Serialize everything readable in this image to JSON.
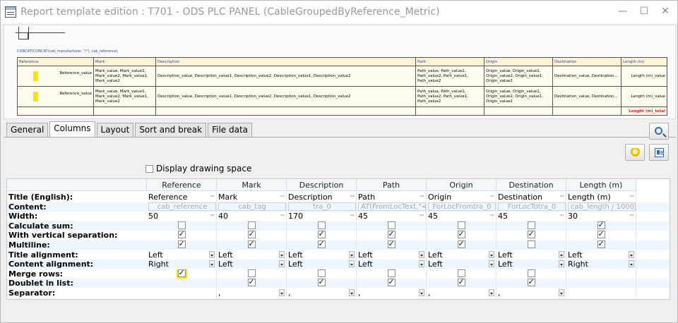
{
  "window": {
    "title": "Report template edition : T701 - ODS PLC PANEL (CableGroupedByReference_Metric)",
    "buttons": {
      "minimize": "—",
      "maximize": "☐",
      "close": "✕"
    }
  },
  "preview": {
    "formula": "CONCAT(CONCAT(cab_manufacturer, \"/\"), cab_reference)",
    "headers": [
      "Reference",
      "Mark",
      "Description",
      "Path",
      "Origin",
      "Destination",
      "Length (m)"
    ],
    "rows": [
      {
        "reference": "Reference_value",
        "mark": "Mark_value, Mark_value1, Mark_value2, Mark_value1, Mark_value2",
        "description": "Description_value, Description_value1, Description_value2, Description_value1, Description_value2",
        "path": "Path_value, Path_value1, Path_value2, Path_value1, Path_value2",
        "origin": "Origin_value, Origin_value1, Origin_value2, Origin_value1, Origin_value2",
        "destination": "Destination_value, Destination...",
        "length": "Length (m)_value"
      },
      {
        "reference": "Reference_value",
        "mark": "Mark_value, Mark_value1, Mark_value2, Mark_value1, Mark_value2",
        "description": "Description_value, Description_value1, Description_value2, Description_value1, Description_value2",
        "path": "Path_value, Path_value1, Path_value2, Path_value1, Path_value2",
        "origin": "Origin_value, Origin_value1, Origin_value2, Origin_value1, Origin_value2",
        "destination": "Destination_value, Destination...",
        "length": "Length (m)_value"
      }
    ],
    "total": "Length (m)_total"
  },
  "tabs": [
    "General",
    "Columns",
    "Layout",
    "Sort and break",
    "File data"
  ],
  "active_tab": "Columns",
  "display_drawing_space": {
    "label": "Display drawing space",
    "checked": false
  },
  "grid": {
    "columns": [
      "Reference",
      "Mark",
      "Description",
      "Path",
      "Origin",
      "Destination",
      "Length (m)"
    ],
    "row_labels": {
      "title": "Title (English):",
      "content": "Content:",
      "width": "Width:",
      "calculate_sum": "Calculate sum:",
      "vertical_sep": "With vertical separation:",
      "multiline": "Multiline:",
      "title_align": "Title alignment:",
      "content_align": "Content alignment:",
      "merge_rows": "Merge rows:",
      "doublet": "Doublet in list:",
      "separator": "Separator:"
    },
    "titles": [
      "Reference",
      "Mark",
      "Description",
      "Path",
      "Origin",
      "Destination",
      "Length (m)"
    ],
    "content": [
      "cab_reference",
      "cab_tag",
      "tra_0",
      "AT(FromLocText,\"<",
      "ForLocFromtra_0",
      "ForLocTotra_0",
      "cab_length / 1000),"
    ],
    "widths": [
      "50",
      "40",
      "170",
      "45",
      "45",
      "45",
      "30"
    ],
    "calculate_sum": [
      false,
      false,
      false,
      false,
      false,
      false,
      true
    ],
    "vertical_sep": [
      true,
      true,
      true,
      true,
      true,
      true,
      true
    ],
    "multiline": [
      true,
      true,
      true,
      true,
      true,
      false,
      true
    ],
    "title_align": [
      "Left",
      "Left",
      "Left",
      "Left",
      "Left",
      "Left",
      "Left"
    ],
    "content_align": [
      "Right",
      "Left",
      "Left",
      "Left",
      "Left",
      "Left",
      "Right"
    ],
    "merge_rows": [
      true,
      false,
      false,
      false,
      false,
      false,
      null
    ],
    "doublet": [
      null,
      true,
      true,
      true,
      true,
      true,
      null
    ],
    "separator": [
      "",
      ",",
      ",",
      ",",
      ",",
      ",",
      ""
    ]
  }
}
